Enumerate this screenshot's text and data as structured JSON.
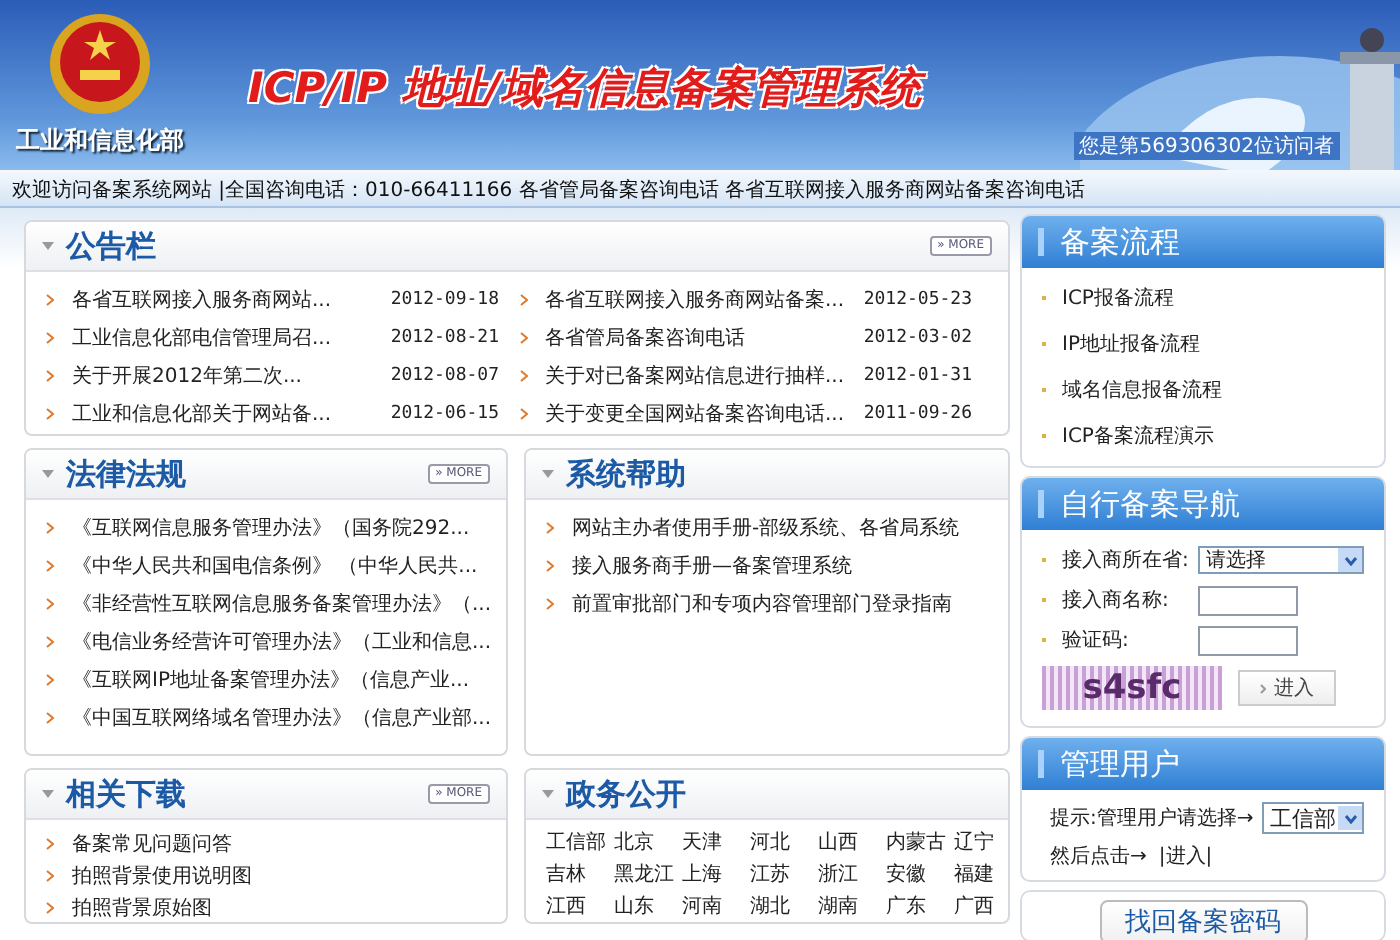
{
  "header": {
    "org": "工业和信息化部",
    "title": "ICP/IP 地址/域名信息备案管理系统",
    "visitor": "您是第569306302位访问者"
  },
  "info_bar": "欢迎访问备案系统网站 |全国咨询电话：010-66411166  各省管局备案咨询电话  各省互联网接入服务商网站备案咨询电话",
  "notices": {
    "title": "公告栏",
    "more": "» MORE",
    "items": [
      {
        "title": "各省互联网接入服务商网站...",
        "date": "2012-09-18"
      },
      {
        "title": "工业信息化部电信管理局召...",
        "date": "2012-08-21"
      },
      {
        "title": "关于开展2012年第二次...",
        "date": "2012-08-07"
      },
      {
        "title": "工业和信息化部关于网站备...",
        "date": "2012-06-15"
      },
      {
        "title": "各省互联网接入服务商网站备案...",
        "date": "2012-05-23"
      },
      {
        "title": "各省管局备案咨询电话",
        "date": "2012-03-02"
      },
      {
        "title": "关于对已备案网站信息进行抽样...",
        "date": "2012-01-31"
      },
      {
        "title": "关于变更全国网站备案咨询电话...",
        "date": "2011-09-26"
      }
    ]
  },
  "laws": {
    "title": "法律法规",
    "more": "» MORE",
    "items": [
      "《互联网信息服务管理办法》（国务院292...",
      "《中华人民共和国电信条例》 （中华人民共...",
      "《非经营性互联网信息服务备案管理办法》（...",
      "《电信业务经营许可管理办法》（工业和信息...",
      "《互联网IP地址备案管理办法》（信息产业...",
      "《中国互联网络域名管理办法》（信息产业部..."
    ]
  },
  "help": {
    "title": "系统帮助",
    "items": [
      "网站主办者使用手册-部级系统、各省局系统",
      "接入服务商手册—备案管理系统",
      "前置审批部门和专项内容管理部门登录指南"
    ]
  },
  "downloads": {
    "title": "相关下载",
    "more": "» MORE",
    "items": [
      "备案常见问题问答",
      "拍照背景使用说明图",
      "拍照背景原始图"
    ]
  },
  "gov": {
    "title": "政务公开",
    "items": [
      "工信部",
      "北京",
      "天津",
      "河北",
      "山西",
      "内蒙古",
      "辽宁",
      "吉林",
      "黑龙江",
      "上海",
      "江苏",
      "浙江",
      "安徽",
      "福建",
      "江西",
      "山东",
      "河南",
      "湖北",
      "湖南",
      "广东",
      "广西"
    ]
  },
  "process": {
    "title": "备案流程",
    "items": [
      "ICP报备流程",
      "IP地址报备流程",
      "域名信息报备流程",
      "ICP备案流程演示"
    ]
  },
  "nav": {
    "title": "自行备案导航",
    "fields": [
      {
        "kind": "select",
        "label": "接入商所在省:",
        "value": "请选择"
      },
      {
        "kind": "input",
        "label": "接入商名称:"
      },
      {
        "kind": "input",
        "label": "验证码:"
      }
    ],
    "captcha": "s4sfc",
    "submit": "进入"
  },
  "admin": {
    "title": "管理用户",
    "hint": "提示:管理用户请选择→",
    "value": "工信部",
    "then": "然后点击→",
    "link": "|进入|"
  },
  "recover": "找回备案密码"
}
